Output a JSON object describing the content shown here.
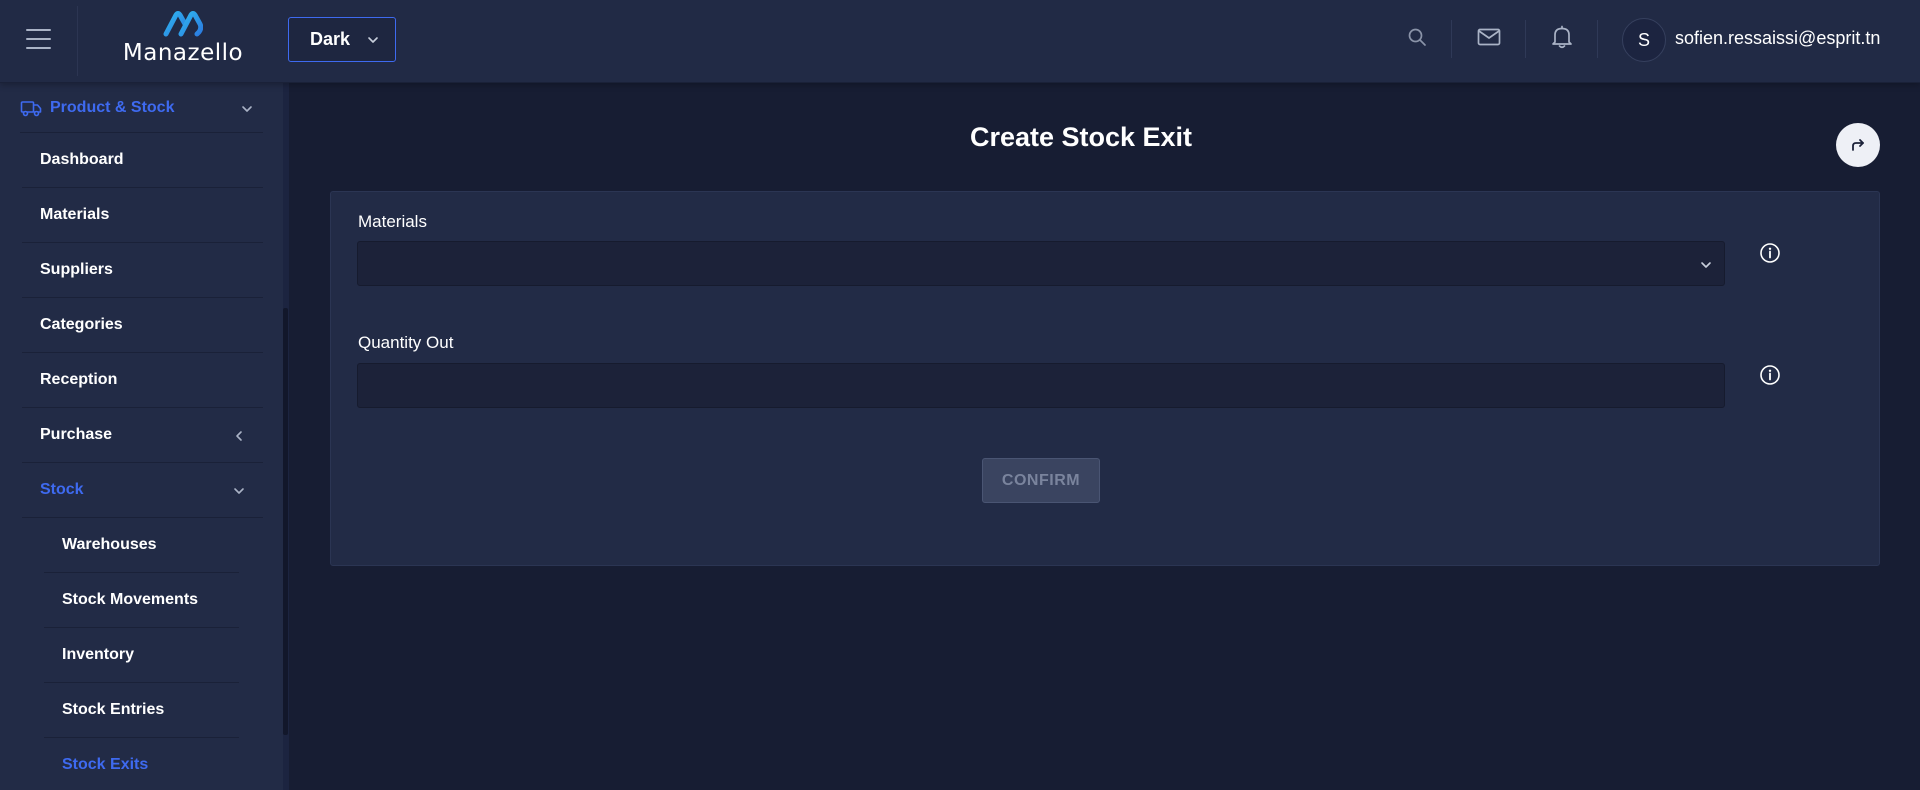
{
  "header": {
    "logo_text": "Manazello",
    "theme_select": {
      "value": "Dark"
    },
    "user": {
      "avatar_initial": "S",
      "email": "sofien.ressaissi@esprit.tn"
    }
  },
  "sidebar": {
    "group": {
      "label": "Product & Stock"
    },
    "items": [
      {
        "label": "Dashboard"
      },
      {
        "label": "Materials"
      },
      {
        "label": "Suppliers"
      },
      {
        "label": "Categories"
      },
      {
        "label": "Reception"
      },
      {
        "label": "Purchase"
      },
      {
        "label": "Stock"
      }
    ],
    "stock_children": [
      {
        "label": "Warehouses"
      },
      {
        "label": "Stock Movements"
      },
      {
        "label": "Inventory"
      },
      {
        "label": "Stock Entries"
      },
      {
        "label": "Stock Exits"
      }
    ]
  },
  "main": {
    "title": "Create Stock Exit",
    "form": {
      "materials_label": "Materials",
      "materials_value": "",
      "quantity_label": "Quantity Out",
      "quantity_value": "",
      "confirm_label": "CONFIRM"
    }
  },
  "colors": {
    "accent": "#3e6af0",
    "background": "#171d33",
    "panel": "#222b46",
    "input": "#1c2239",
    "disabled_button": "#3a4460"
  }
}
